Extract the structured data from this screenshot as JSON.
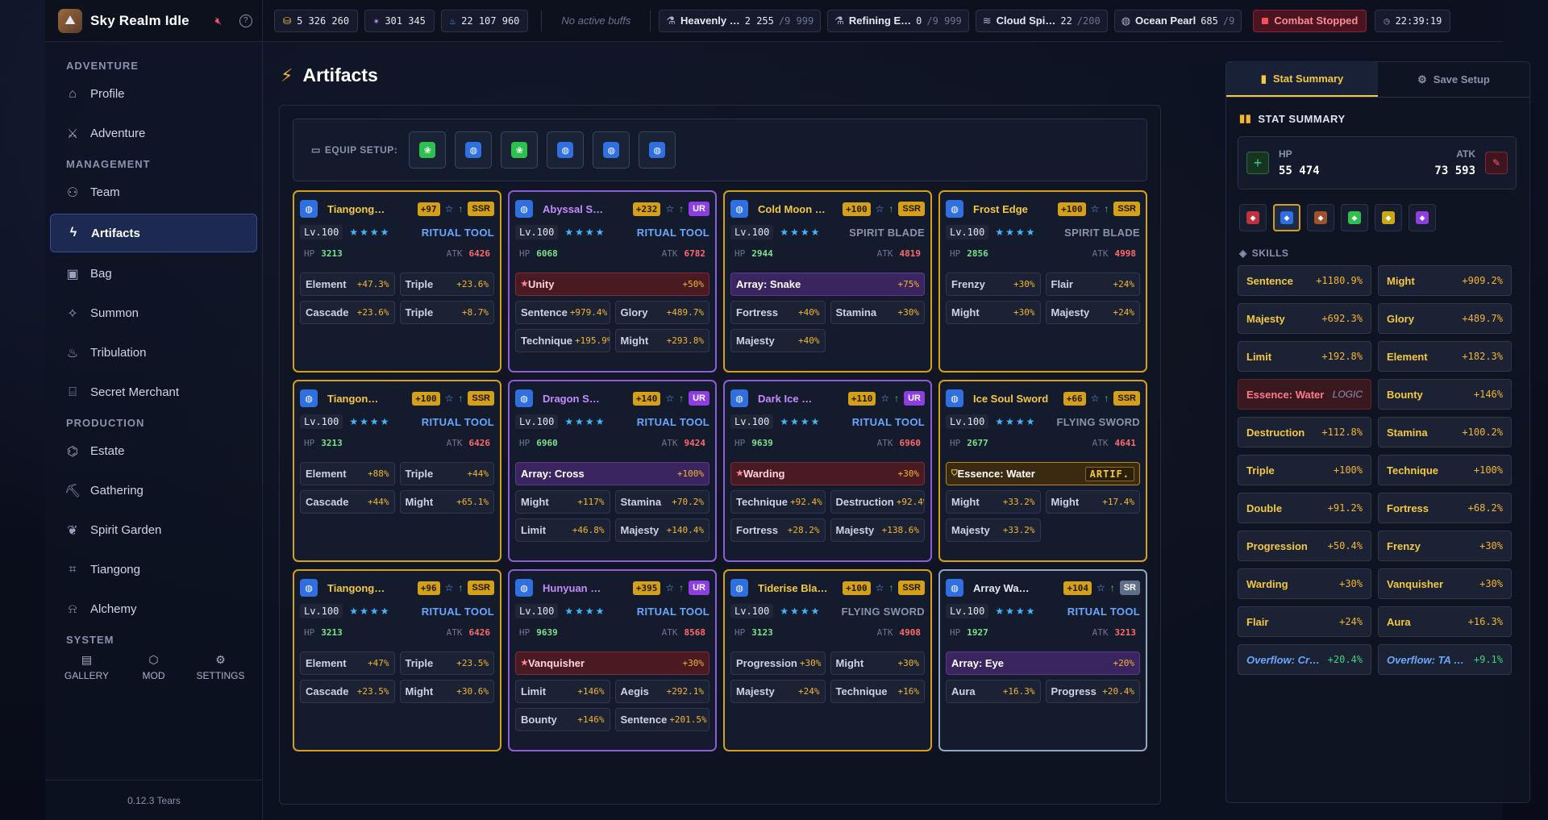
{
  "app": {
    "title": "Sky Realm Idle",
    "version": "0.12.3 Tears"
  },
  "topbar": {
    "resources": [
      {
        "icon": "coin-icon",
        "value": "5 326 260",
        "color": "#f5c842"
      },
      {
        "icon": "spark-icon",
        "value": "301 345",
        "color": "#c58cff"
      },
      {
        "icon": "flame-icon",
        "value": "22 107 960",
        "color": "#6aa6ff"
      }
    ],
    "buffs": "No active buffs",
    "materials": [
      {
        "icon": "flask-icon",
        "name": "Heavenly …",
        "count": "2 255",
        "cap": "/9 999"
      },
      {
        "icon": "flask-icon",
        "name": "Refining E…",
        "count": "0",
        "cap": "/9 999"
      },
      {
        "icon": "wind-icon",
        "name": "Cloud Spi…",
        "count": "22",
        "cap": "/200"
      },
      {
        "icon": "drop-icon",
        "name": "Ocean Pearl",
        "count": "685",
        "cap": "/9"
      }
    ],
    "combat": "Combat Stopped",
    "clock": "22:39:19"
  },
  "sidebar": {
    "sections": [
      {
        "title": "ADVENTURE",
        "items": [
          {
            "label": "Profile",
            "icon": "house-icon"
          },
          {
            "label": "Adventure",
            "icon": "sword-icon"
          }
        ]
      },
      {
        "title": "MANAGEMENT",
        "items": [
          {
            "label": "Team",
            "icon": "users-icon"
          },
          {
            "label": "Artifacts",
            "icon": "bolt-icon",
            "active": true
          },
          {
            "label": "Bag",
            "icon": "backpack-icon"
          },
          {
            "label": "Summon",
            "icon": "sparkles-icon"
          },
          {
            "label": "Tribulation",
            "icon": "flame-icon"
          },
          {
            "label": "Secret Merchant",
            "icon": "store-icon"
          }
        ]
      },
      {
        "title": "PRODUCTION",
        "items": [
          {
            "label": "Estate",
            "icon": "factory-icon"
          },
          {
            "label": "Gathering",
            "icon": "pickaxe-icon"
          },
          {
            "label": "Spirit Garden",
            "icon": "sprout-icon"
          },
          {
            "label": "Tiangong",
            "icon": "chart-icon"
          },
          {
            "label": "Alchemy",
            "icon": "cauldron-icon"
          }
        ]
      }
    ],
    "system_title": "SYSTEM",
    "system": [
      {
        "label": "GALLERY",
        "icon": "book-icon"
      },
      {
        "label": "MOD",
        "icon": "cube-icon"
      },
      {
        "label": "SETTINGS",
        "icon": "gear-icon"
      }
    ]
  },
  "main": {
    "title": "Artifacts",
    "equip_label": "EQUIP SETUP:",
    "equip_slots": [
      {
        "element": "wood",
        "color": "#2fbf4f"
      },
      {
        "element": "water",
        "color": "#2f6fe0"
      },
      {
        "element": "wood",
        "color": "#2fbf4f"
      },
      {
        "element": "water",
        "color": "#2f6fe0"
      },
      {
        "element": "water",
        "color": "#2f6fe0"
      },
      {
        "element": "water",
        "color": "#2f6fe0"
      }
    ],
    "cards": [
      {
        "name": "Tiangong…",
        "plus": "+97",
        "rarity": "SSR",
        "level": "Lv.100",
        "type": "RITUAL TOOL",
        "type_style": "blue",
        "hp": "3213",
        "atk": "6426",
        "subs": [
          {
            "k": "Element",
            "v": "+47.3%"
          },
          {
            "k": "Triple",
            "v": "+23.6%"
          },
          {
            "k": "Cascade",
            "v": "+23.6%"
          },
          {
            "k": "Triple",
            "v": "+8.7%"
          }
        ]
      },
      {
        "name": "Abyssal S…",
        "plus": "+232",
        "rarity": "UR",
        "level": "Lv.100",
        "type": "RITUAL TOOL",
        "type_style": "blue",
        "hp": "6068",
        "atk": "6782",
        "special": {
          "k": "Unity",
          "v": "+50%",
          "style": "red",
          "star": true
        },
        "subs": [
          {
            "k": "Sentence",
            "v": "+979.4%"
          },
          {
            "k": "Glory",
            "v": "+489.7%"
          },
          {
            "k": "Technique",
            "v": "+195.9%"
          },
          {
            "k": "Might",
            "v": "+293.8%"
          }
        ]
      },
      {
        "name": "Cold Moon …",
        "plus": "+100",
        "rarity": "SSR",
        "level": "Lv.100",
        "type": "SPIRIT BLADE",
        "type_style": "grey",
        "hp": "2944",
        "atk": "4819",
        "special": {
          "k": "Array: Snake",
          "v": "+75%",
          "style": "purple"
        },
        "subs": [
          {
            "k": "Fortress",
            "v": "+40%"
          },
          {
            "k": "Stamina",
            "v": "+30%"
          },
          {
            "k": "Majesty",
            "v": "+40%"
          }
        ]
      },
      {
        "name": "Frost Edge",
        "plus": "+100",
        "rarity": "SSR",
        "level": "Lv.100",
        "type": "SPIRIT BLADE",
        "type_style": "grey",
        "hp": "2856",
        "atk": "4998",
        "subs": [
          {
            "k": "Frenzy",
            "v": "+30%"
          },
          {
            "k": "Flair",
            "v": "+24%"
          },
          {
            "k": "Might",
            "v": "+30%"
          },
          {
            "k": "Majesty",
            "v": "+24%"
          }
        ]
      },
      {
        "name": "Tiangon…",
        "plus": "+100",
        "rarity": "SSR",
        "level": "Lv.100",
        "type": "RITUAL TOOL",
        "type_style": "blue",
        "hp": "3213",
        "atk": "6426",
        "subs": [
          {
            "k": "Element",
            "v": "+88%"
          },
          {
            "k": "Triple",
            "v": "+44%"
          },
          {
            "k": "Cascade",
            "v": "+44%"
          },
          {
            "k": "Might",
            "v": "+65.1%"
          }
        ]
      },
      {
        "name": "Dragon S…",
        "plus": "+140",
        "rarity": "UR",
        "level": "Lv.100",
        "type": "RITUAL TOOL",
        "type_style": "blue",
        "hp": "6960",
        "atk": "9424",
        "special": {
          "k": "Array: Cross",
          "v": "+100%",
          "style": "purple"
        },
        "subs": [
          {
            "k": "Might",
            "v": "+117%"
          },
          {
            "k": "Stamina",
            "v": "+70.2%"
          },
          {
            "k": "Limit",
            "v": "+46.8%"
          },
          {
            "k": "Majesty",
            "v": "+140.4%"
          }
        ]
      },
      {
        "name": "Dark Ice …",
        "plus": "+110",
        "rarity": "UR",
        "level": "Lv.100",
        "type": "RITUAL TOOL",
        "type_style": "blue",
        "hp": "9639",
        "atk": "6960",
        "special": {
          "k": "Warding",
          "v": "+30%",
          "style": "red",
          "star": true
        },
        "subs": [
          {
            "k": "Technique",
            "v": "+92.4%"
          },
          {
            "k": "Destruction",
            "v": "+92.4%"
          },
          {
            "k": "Fortress",
            "v": "+28.2%"
          },
          {
            "k": "Majesty",
            "v": "+138.6%"
          }
        ]
      },
      {
        "name": "Ice Soul Sword",
        "plus": "+66",
        "rarity": "SSR",
        "level": "Lv.100",
        "type": "FLYING SWORD",
        "type_style": "grey",
        "hp": "2677",
        "atk": "4641",
        "special": {
          "k": "Essence: Water",
          "tag": "ARTIF.",
          "style": "gold",
          "shield": true
        },
        "subs": [
          {
            "k": "Might",
            "v": "+33.2%"
          },
          {
            "k": "Might",
            "v": "+17.4%"
          },
          {
            "k": "Majesty",
            "v": "+33.2%"
          }
        ]
      },
      {
        "name": "Tiangong…",
        "plus": "+96",
        "rarity": "SSR",
        "level": "Lv.100",
        "type": "RITUAL TOOL",
        "type_style": "blue",
        "hp": "3213",
        "atk": "6426",
        "subs": [
          {
            "k": "Element",
            "v": "+47%"
          },
          {
            "k": "Triple",
            "v": "+23.5%"
          },
          {
            "k": "Cascade",
            "v": "+23.5%"
          },
          {
            "k": "Might",
            "v": "+30.6%"
          }
        ]
      },
      {
        "name": "Hunyuan …",
        "plus": "+395",
        "rarity": "UR",
        "level": "Lv.100",
        "type": "RITUAL TOOL",
        "type_style": "blue",
        "hp": "9639",
        "atk": "8568",
        "special": {
          "k": "Vanquisher",
          "v": "+30%",
          "style": "red",
          "star": true
        },
        "subs": [
          {
            "k": "Limit",
            "v": "+146%"
          },
          {
            "k": "Aegis",
            "v": "+292.1%"
          },
          {
            "k": "Bounty",
            "v": "+146%"
          },
          {
            "k": "Sentence",
            "v": "+201.5%"
          }
        ]
      },
      {
        "name": "Tiderise Bla…",
        "plus": "+100",
        "rarity": "SSR",
        "level": "Lv.100",
        "type": "FLYING SWORD",
        "type_style": "grey",
        "hp": "3123",
        "atk": "4908",
        "subs": [
          {
            "k": "Progression",
            "v": "+30%"
          },
          {
            "k": "Might",
            "v": "+30%"
          },
          {
            "k": "Majesty",
            "v": "+24%"
          },
          {
            "k": "Technique",
            "v": "+16%"
          }
        ]
      },
      {
        "name": "Array Wa…",
        "plus": "+104",
        "rarity": "SR",
        "level": "Lv.100",
        "type": "RITUAL TOOL",
        "type_style": "blue",
        "hp": "1927",
        "atk": "3213",
        "special": {
          "k": "Array: Eye",
          "v": "+20%",
          "style": "purple"
        },
        "subs": [
          {
            "k": "Aura",
            "v": "+16.3%"
          },
          {
            "k": "Progress",
            "v": "+20.4%"
          }
        ]
      }
    ]
  },
  "right": {
    "tabs": [
      {
        "label": "Stat Summary",
        "icon": "bar-chart-icon",
        "active": true
      },
      {
        "label": "Save Setup",
        "icon": "gear-icon"
      }
    ],
    "section_title": "STAT SUMMARY",
    "hp_label": "HP",
    "hp_value": "55 474",
    "atk_label": "ATK",
    "atk_value": "73 593",
    "element_filters": [
      {
        "element": "fire",
        "color": "#c0303f"
      },
      {
        "element": "water",
        "color": "#2f6fe0",
        "active": true
      },
      {
        "element": "earth",
        "color": "#a0502a"
      },
      {
        "element": "wood",
        "color": "#2fbf4f"
      },
      {
        "element": "metal",
        "color": "#c9a816"
      },
      {
        "element": "void",
        "color": "#8e3ee0"
      }
    ],
    "skills_title": "SKILLS",
    "skills": [
      {
        "k": "Sentence",
        "v": "+1180.9%"
      },
      {
        "k": "Might",
        "v": "+909.2%"
      },
      {
        "k": "Majesty",
        "v": "+692.3%"
      },
      {
        "k": "Glory",
        "v": "+489.7%"
      },
      {
        "k": "Limit",
        "v": "+192.8%"
      },
      {
        "k": "Element",
        "v": "+182.3%"
      },
      {
        "k": "Essence: Water",
        "v": "LOGIC",
        "style": "red"
      },
      {
        "k": "Bounty",
        "v": "+146%"
      },
      {
        "k": "Destruction",
        "v": "+112.8%"
      },
      {
        "k": "Stamina",
        "v": "+100.2%"
      },
      {
        "k": "Triple",
        "v": "+100%"
      },
      {
        "k": "Technique",
        "v": "+100%"
      },
      {
        "k": "Double",
        "v": "+91.2%"
      },
      {
        "k": "Fortress",
        "v": "+68.2%"
      },
      {
        "k": "Progression",
        "v": "+50.4%"
      },
      {
        "k": "Frenzy",
        "v": "+30%"
      },
      {
        "k": "Warding",
        "v": "+30%"
      },
      {
        "k": "Vanquisher",
        "v": "+30%"
      },
      {
        "k": "Flair",
        "v": "+24%"
      },
      {
        "k": "Aura",
        "v": "+16.3%"
      },
      {
        "k": "Overflow: Cr…",
        "v": "+20.4%",
        "style": "over"
      },
      {
        "k": "Overflow: TA …",
        "v": "+9.1%",
        "style": "over"
      }
    ]
  }
}
